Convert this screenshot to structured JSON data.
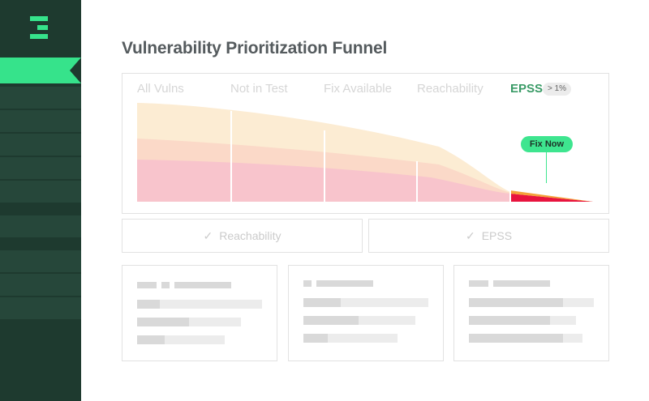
{
  "sidebar": {
    "logo_icon": "e-logo-icon",
    "active_item": 0
  },
  "page": {
    "title": "Vulnerability Prioritization Funnel"
  },
  "funnel": {
    "stages": [
      "All Vulns",
      "Not in Test",
      "Fix Available",
      "Reachability",
      "EPSS"
    ],
    "active_stage": "EPSS",
    "epss_threshold": "> 1%",
    "callout": "Fix Now",
    "colors": {
      "outer": "#fcecd3",
      "middle": "#fbd9c8",
      "inner": "#f8c4cc",
      "highlight": "#e8143e",
      "accent": "#36e38b"
    }
  },
  "filters": [
    {
      "label": "Reachability",
      "icon": "check-icon"
    },
    {
      "label": "EPSS",
      "icon": "check-icon"
    }
  ]
}
